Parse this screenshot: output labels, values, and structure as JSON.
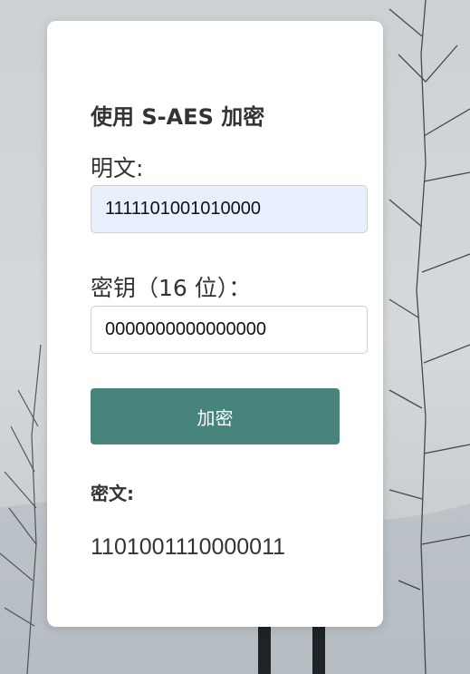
{
  "form": {
    "title": "使用 S-AES 加密",
    "plaintext_label": "明文:",
    "plaintext_value": "1111101001010000",
    "key_label": "密钥（16 位）：",
    "key_value": "0000000000000000",
    "encrypt_button": "加密",
    "ciphertext_label": "密文:",
    "ciphertext_value": "1101001110000011"
  },
  "colors": {
    "button": "#46847c",
    "autofill_input": "#e8f0fe",
    "card": "#ffffff"
  }
}
